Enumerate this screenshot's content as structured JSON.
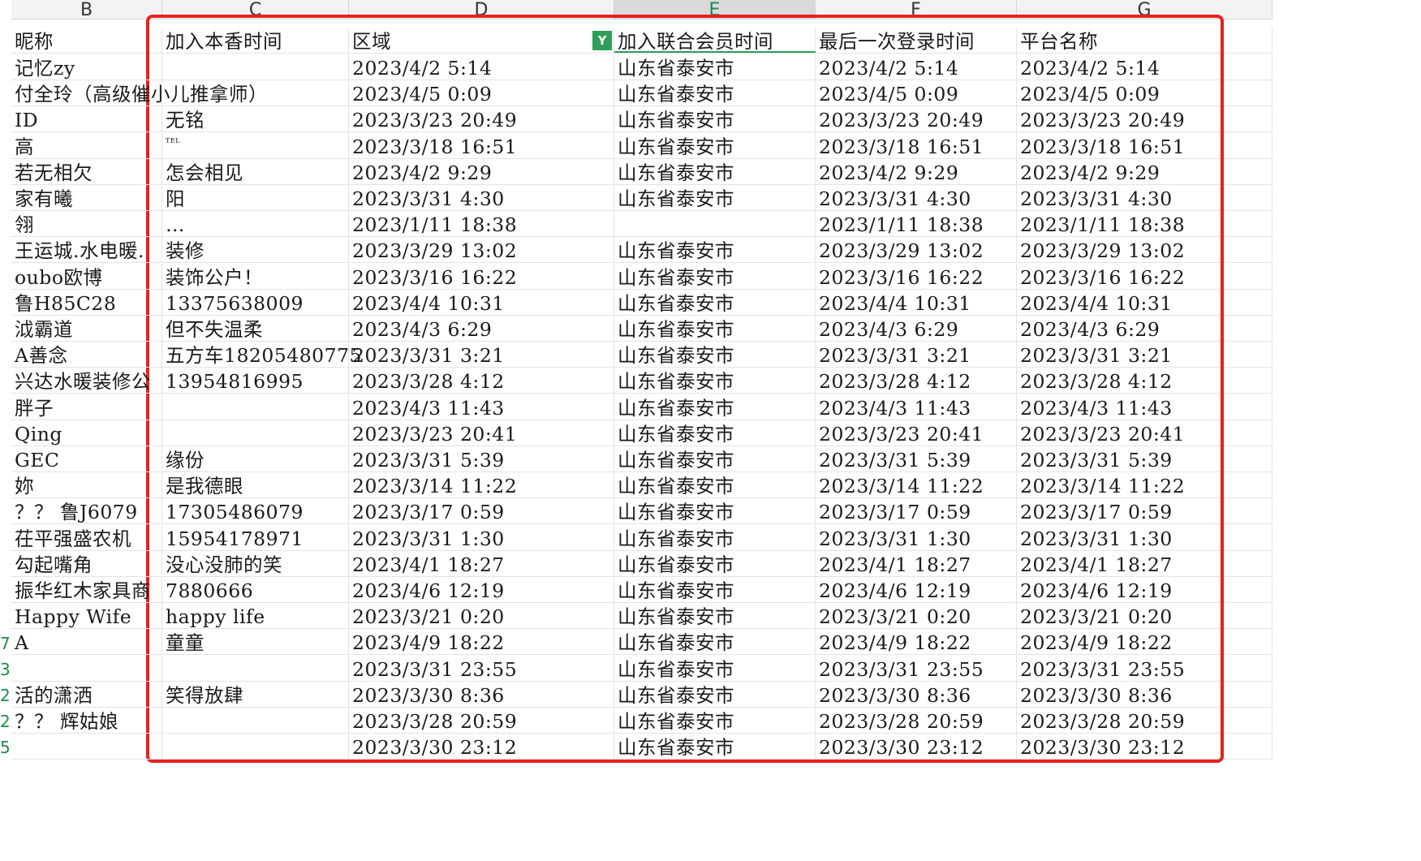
{
  "columns": {
    "B": "B",
    "C": "C",
    "D": "D",
    "E": "E",
    "F": "F",
    "G": "G"
  },
  "headers": {
    "nickname": "昵称",
    "join_time": "加入本香时间",
    "region": "区域",
    "alliance_join_time": "加入联合会员时间",
    "last_login": "最后一次登录时间",
    "platform": "平台名称"
  },
  "row_numbers": [
    "7",
    "3",
    "2",
    "2",
    "5"
  ],
  "rows": [
    {
      "b": "记忆zy",
      "c": "",
      "d": "2023/4/2  5:14",
      "e": "山东省泰安市",
      "f": "2023/4/2  5:14",
      "g": "2023/4/2  5:14"
    },
    {
      "b": "付全玲（高级催小儿推拿师）",
      "c": "",
      "d": "2023/4/5  0:09",
      "e": "山东省泰安市",
      "f": "2023/4/5  0:09",
      "g": "2023/4/5  0:09"
    },
    {
      "b": "ID",
      "c": "无铭",
      "d": "2023/3/23  20:49",
      "e": "山东省泰安市",
      "f": "2023/3/23  20:49",
      "g": "2023/3/23  20:49"
    },
    {
      "b": "高",
      "c": "TEL",
      "d": "2023/3/18  16:51",
      "e": "山东省泰安市",
      "f": "2023/3/18  16:51",
      "g": "2023/3/18  16:51"
    },
    {
      "b": "若无相欠",
      "c": "怎会相见",
      "d": "2023/4/2  9:29",
      "e": "山东省泰安市",
      "f": "2023/4/2  9:29",
      "g": "2023/4/2  9:29"
    },
    {
      "b": "家有曦",
      "c": "阳",
      "d": "2023/3/31  4:30",
      "e": "山东省泰安市",
      "f": "2023/3/31  4:30",
      "g": "2023/3/31  4:30"
    },
    {
      "b": "翎",
      "c": "…",
      "d": "2023/1/11  18:38",
      "e": "",
      "f": "2023/1/11  18:38",
      "g": "2023/1/11  18:38"
    },
    {
      "b": "王运城.水电暖.",
      "c": "装修",
      "d": "2023/3/29  13:02",
      "e": "山东省泰安市",
      "f": "2023/3/29  13:02",
      "g": "2023/3/29  13:02"
    },
    {
      "b": "oubo欧博",
      "c": "装饰公户！",
      "d": "2023/3/16  16:22",
      "e": "山东省泰安市",
      "f": "2023/3/16  16:22",
      "g": "2023/3/16  16:22"
    },
    {
      "b": "鲁H85C28",
      "c": "13375638009",
      "d": "2023/4/4  10:31",
      "e": "山东省泰安市",
      "f": "2023/4/4  10:31",
      "g": "2023/4/4  10:31"
    },
    {
      "b": "泧霸道",
      "c": "但不失温柔",
      "d": "2023/4/3  6:29",
      "e": "山东省泰安市",
      "f": "2023/4/3  6:29",
      "g": "2023/4/3  6:29"
    },
    {
      "b": "A善念",
      "c": "五方车18205480775",
      "d": "2023/3/31  3:21",
      "e": "山东省泰安市",
      "f": "2023/3/31  3:21",
      "g": "2023/3/31  3:21"
    },
    {
      "b": "兴达水暖装修公",
      "c": "13954816995",
      "d": "2023/3/28  4:12",
      "e": "山东省泰安市",
      "f": "2023/3/28  4:12",
      "g": "2023/3/28  4:12"
    },
    {
      "b": "胖子",
      "c": "",
      "d": "2023/4/3  11:43",
      "e": "山东省泰安市",
      "f": "2023/4/3  11:43",
      "g": "2023/4/3  11:43"
    },
    {
      "b": "Qing",
      "c": "",
      "d": "2023/3/23  20:41",
      "e": "山东省泰安市",
      "f": "2023/3/23  20:41",
      "g": "2023/3/23  20:41"
    },
    {
      "b": "GEC",
      "c": "缘份",
      "d": "2023/3/31  5:39",
      "e": "山东省泰安市",
      "f": "2023/3/31  5:39",
      "g": "2023/3/31  5:39"
    },
    {
      "b": "妳",
      "c": "是我德眼",
      "d": "2023/3/14  11:22",
      "e": "山东省泰安市",
      "f": "2023/3/14  11:22",
      "g": "2023/3/14  11:22"
    },
    {
      "b": "？？  鲁J6079",
      "c": "17305486079",
      "d": "2023/3/17  0:59",
      "e": "山东省泰安市",
      "f": "2023/3/17  0:59",
      "g": "2023/3/17  0:59"
    },
    {
      "b": "茌平强盛农机",
      "c": "15954178971",
      "d": "2023/3/31  1:30",
      "e": "山东省泰安市",
      "f": "2023/3/31  1:30",
      "g": "2023/3/31  1:30"
    },
    {
      "b": "勾起嘴角",
      "c": "没心没肺的笑",
      "d": "2023/4/1  18:27",
      "e": "山东省泰安市",
      "f": "2023/4/1  18:27",
      "g": "2023/4/1  18:27"
    },
    {
      "b": "振华红木家具商",
      "c": "7880666",
      "d": "2023/4/6  12:19",
      "e": "山东省泰安市",
      "f": "2023/4/6  12:19",
      "g": "2023/4/6  12:19"
    },
    {
      "b": "Happy Wife",
      "c": " happy life",
      "d": "2023/3/21  0:20",
      "e": "山东省泰安市",
      "f": "2023/3/21  0:20",
      "g": "2023/3/21  0:20"
    },
    {
      "b": "A",
      "c": "童童",
      "d": "2023/4/9  18:22",
      "e": "山东省泰安市",
      "f": "2023/4/9  18:22",
      "g": "2023/4/9  18:22"
    },
    {
      "b": "",
      "c": "",
      "d": "2023/3/31  23:55",
      "e": "山东省泰安市",
      "f": "2023/3/31  23:55",
      "g": "2023/3/31  23:55"
    },
    {
      "b": "活的潇洒",
      "c": "笑得放肆",
      "d": "2023/3/30  8:36",
      "e": "山东省泰安市",
      "f": "2023/3/30  8:36",
      "g": "2023/3/30  8:36"
    },
    {
      "b": "？？ 辉姑娘",
      "c": "",
      "d": "2023/3/28  20:59",
      "e": "山东省泰安市",
      "f": "2023/3/28  20:59",
      "g": "2023/3/28  20:59"
    },
    {
      "b": "",
      "c": "",
      "d": "2023/3/30  23:12",
      "e": "山东省泰安市",
      "f": "2023/3/30  23:12",
      "g": "2023/3/30  23:12"
    }
  ],
  "colors": {
    "highlight_box": "#e8201f",
    "accent_green": "#2e9e5b"
  },
  "icons": {
    "filter": "filter-active-icon"
  }
}
